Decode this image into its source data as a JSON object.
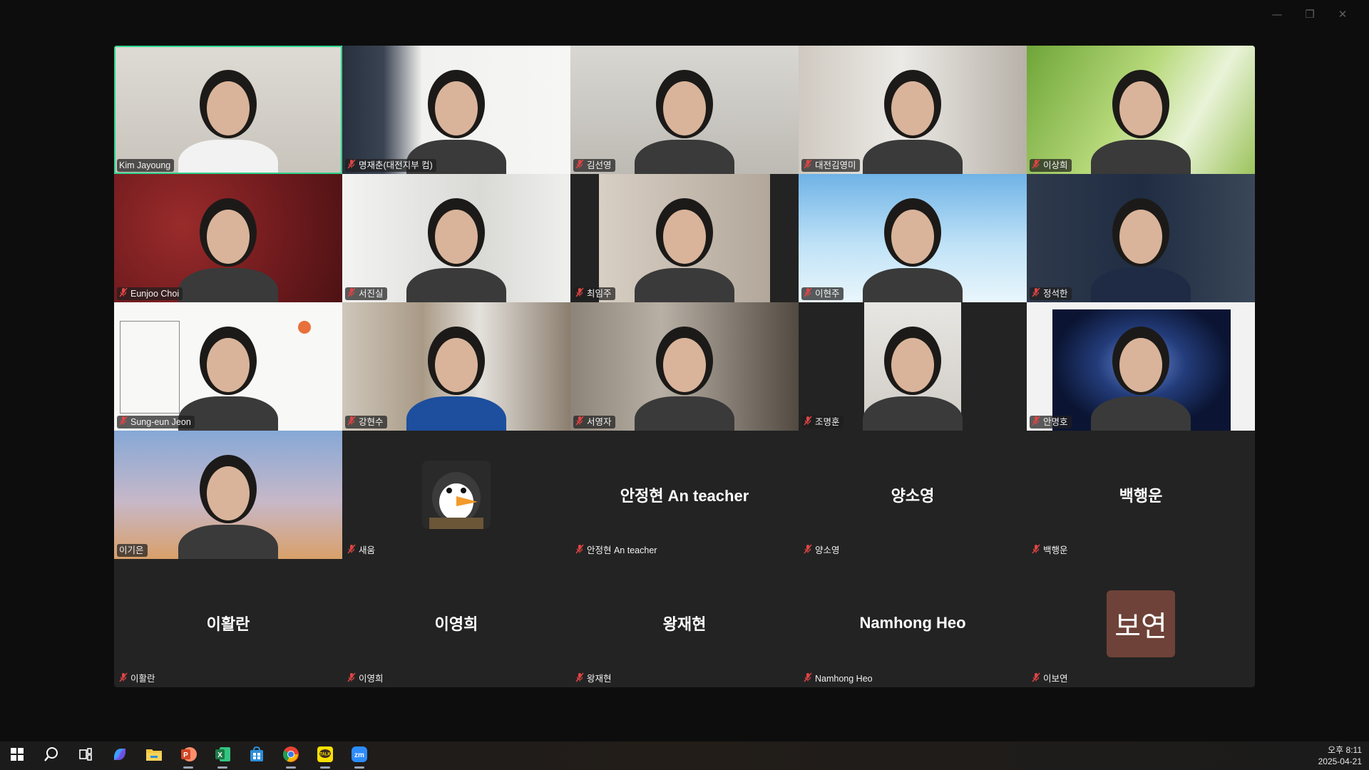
{
  "window": {
    "controls": [
      "minimize",
      "restore",
      "close"
    ]
  },
  "participants": [
    {
      "name": "Kim Jayoung",
      "muted": false,
      "active": true,
      "video": "v-bright"
    },
    {
      "name": "명재춘(대전지부 컴)",
      "muted": true,
      "video": "v-office"
    },
    {
      "name": "김선영",
      "muted": true,
      "video": "v-grey"
    },
    {
      "name": "대전김영미",
      "muted": true,
      "video": "v-room"
    },
    {
      "name": "이상희",
      "muted": true,
      "video": "v-grass"
    },
    {
      "name": "Eunjoo Choi",
      "muted": true,
      "video": "v-red"
    },
    {
      "name": "서진실",
      "muted": true,
      "video": "v-wall"
    },
    {
      "name": "최임주",
      "muted": true,
      "video": "v-dark-split"
    },
    {
      "name": "이현주",
      "muted": true,
      "video": "v-sky"
    },
    {
      "name": "정석한",
      "muted": true,
      "video": "v-blue"
    },
    {
      "name": "Sung-eun Jeon",
      "muted": true,
      "video": "v-drawing"
    },
    {
      "name": "강현수",
      "muted": true,
      "video": "v-books"
    },
    {
      "name": "서영자",
      "muted": true,
      "video": "v-dim"
    },
    {
      "name": "조명훈",
      "muted": true,
      "video": "v-dark-split"
    },
    {
      "name": "안명호",
      "muted": true,
      "video": "v-galaxy"
    },
    {
      "name": "이기은",
      "muted": false,
      "video": "v-cathedral"
    },
    {
      "name": "새움",
      "muted": true,
      "avatar": "penguin"
    },
    {
      "name": "안정현 An teacher",
      "muted": true,
      "center_name": "안정현 An teacher"
    },
    {
      "name": "양소영",
      "muted": true,
      "center_name": "양소영"
    },
    {
      "name": "백행운",
      "muted": true,
      "center_name": "백행운"
    },
    {
      "name": "이활란",
      "muted": true,
      "center_name": "이활란"
    },
    {
      "name": "이영희",
      "muted": true,
      "center_name": "이영희"
    },
    {
      "name": "왕재현",
      "muted": true,
      "center_name": "왕재현"
    },
    {
      "name": "Namhong Heo",
      "muted": true,
      "center_name": "Namhong Heo"
    },
    {
      "name": "이보연",
      "muted": true,
      "avatar_text": "보연"
    }
  ],
  "taskbar": {
    "apps": [
      {
        "name": "windows-start-icon",
        "color": "#ffffff"
      },
      {
        "name": "search-icon",
        "color": "#ffffff"
      },
      {
        "name": "task-view-icon",
        "color": "#ffffff"
      },
      {
        "name": "copilot-icon",
        "color": "#7a5cff"
      },
      {
        "name": "file-explorer-icon",
        "color": "#f2c744"
      },
      {
        "name": "powerpoint-icon",
        "color": "#d24726",
        "running": true
      },
      {
        "name": "excel-icon",
        "color": "#1d7a45",
        "running": true
      },
      {
        "name": "store-icon",
        "color": "#2d8fd8"
      },
      {
        "name": "chrome-icon",
        "color": "#e84335",
        "running": true
      },
      {
        "name": "kakaotalk-icon",
        "color": "#f9e000",
        "running": true
      },
      {
        "name": "zoom-icon",
        "color": "#2d8cff",
        "running": true
      }
    ],
    "time": "오후 8:11",
    "date": "2025-04-21"
  }
}
